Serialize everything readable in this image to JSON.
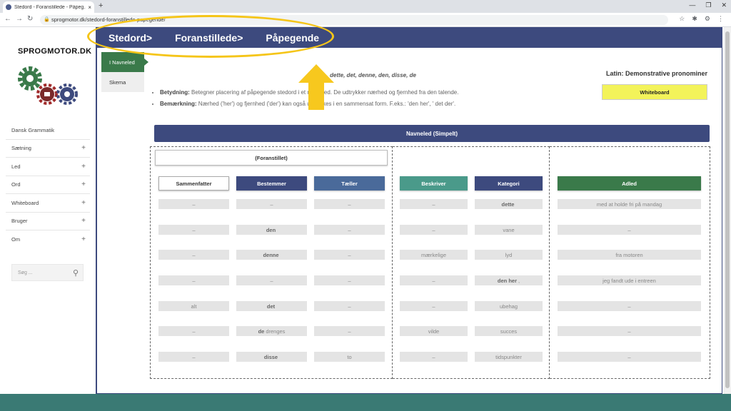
{
  "browser": {
    "tab_title": "Stedord - Foranstillede - Påpeg...",
    "close_glyph": "×",
    "new_tab_glyph": "+",
    "url": "sprogmotor.dk/stedord-foranstillede-papegende/",
    "lock_glyph": "🔒",
    "back_glyph": "←",
    "forward_glyph": "→",
    "reload_glyph": "↻",
    "icons": [
      "star-icon",
      "extensions-icon",
      "settings-icon",
      "menu-icon"
    ],
    "window_controls": [
      "—",
      "❐",
      "✕"
    ]
  },
  "sidebar": {
    "logo": "SPROGMOTOR.DK",
    "items": [
      {
        "label": "Dansk Grammatik",
        "expandable": false
      },
      {
        "label": "Sætning",
        "expandable": true
      },
      {
        "label": "Led",
        "expandable": true
      },
      {
        "label": "Ord",
        "expandable": true
      },
      {
        "label": "Whiteboard",
        "expandable": true
      },
      {
        "label": "Bruger",
        "expandable": true
      },
      {
        "label": "Om",
        "expandable": true
      }
    ],
    "plus_glyph": "+",
    "search_placeholder": "Søg ...",
    "search_icon_glyph": "⚲"
  },
  "topnav": {
    "crumbs": [
      "Stedord>",
      "Foranstillede>",
      "Påpegende"
    ],
    "highlight_color": "#f5c518",
    "nav_color": "#3d4a7e"
  },
  "subtabs": [
    "I Navneled",
    "Skema"
  ],
  "content": {
    "words": "dette, det, denne, den, disse, de",
    "latin": "Latin: Demonstrative pronominer",
    "whiteboard_button": "Whiteboard",
    "bullets": [
      {
        "label": "Betydning:",
        "text": " Betegner placering af påpegende stedord i et navneled. De udtrykker nærhed og fjernhed fra den talende."
      },
      {
        "label": "Bemærkning:",
        "text": " Nærhed ('her') og fjernhed ('der') kan også udtrykkes i en sammensat form. F.eks.: 'den her', ' det der'."
      }
    ]
  },
  "table": {
    "title": "Navneled (Simpelt)",
    "group_label": "(Foranstillet)",
    "columns": [
      {
        "label": "Sammenfatter",
        "bg": "#ffffff",
        "fg": "#333333"
      },
      {
        "label": "Bestemmer",
        "bg": "#3d4a7e",
        "fg": "#ffffff"
      },
      {
        "label": "Tæller",
        "bg": "#4a6a9a",
        "fg": "#ffffff"
      },
      {
        "label": "Beskriver",
        "bg": "#4a9a8a",
        "fg": "#ffffff"
      },
      {
        "label": "Kategori",
        "bg": "#3d4a7e",
        "fg": "#ffffff"
      },
      {
        "label": "Adled",
        "bg": "#3a7a4a",
        "fg": "#ffffff"
      }
    ],
    "rows": [
      [
        {
          "t": "–"
        },
        {
          "t": "–"
        },
        {
          "t": "–"
        },
        {
          "t": "–"
        },
        {
          "b": "dette"
        },
        {
          "t": "med at holde fri på mandag"
        }
      ],
      [
        {
          "t": "–"
        },
        {
          "b": "den"
        },
        {
          "t": "–"
        },
        {
          "t": "–"
        },
        {
          "t": "vane"
        },
        {
          "t": "–"
        }
      ],
      [
        {
          "t": "–"
        },
        {
          "b": "denne"
        },
        {
          "t": "–"
        },
        {
          "t": "mærkelige"
        },
        {
          "t": "lyd"
        },
        {
          "t": "fra motoren"
        }
      ],
      [
        {
          "t": "–"
        },
        {
          "t": "–"
        },
        {
          "t": "–"
        },
        {
          "t": "–"
        },
        {
          "b": "den her",
          "t": ","
        },
        {
          "t": "jeg fandt ude i entreen"
        }
      ],
      [
        {
          "t": "alt"
        },
        {
          "b": "det"
        },
        {
          "t": "–"
        },
        {
          "t": "–"
        },
        {
          "t": "ubehag"
        },
        {
          "t": "–"
        }
      ],
      [
        {
          "t": "–"
        },
        {
          "b": "de",
          "t": "drenges"
        },
        {
          "t": "–"
        },
        {
          "t": "vilde"
        },
        {
          "t": "succes"
        },
        {
          "t": "–"
        }
      ],
      [
        {
          "t": "–"
        },
        {
          "b": "disse"
        },
        {
          "t": "to"
        },
        {
          "t": "–"
        },
        {
          "t": "tidspunkter"
        },
        {
          "t": "–"
        }
      ]
    ]
  },
  "colors": {
    "footer": "#3a7a74",
    "active_subtab": "#3a7a4a",
    "whiteboard": "#f3f35a"
  }
}
